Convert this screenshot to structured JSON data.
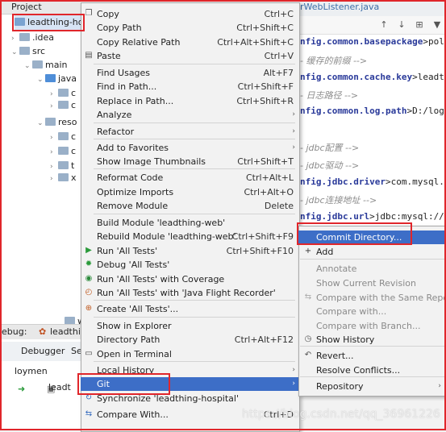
{
  "project_panel": {
    "header": "Project",
    "tree": [
      {
        "label": "leadthing-hosp",
        "selected": true
      },
      {
        "label": ".idea"
      },
      {
        "label": "src"
      },
      {
        "label": "main"
      },
      {
        "label": "java"
      },
      {
        "label": "c"
      },
      {
        "label": "c"
      },
      {
        "label": "c"
      },
      {
        "label": "reso"
      },
      {
        "label": "c"
      },
      {
        "label": "c"
      },
      {
        "label": "t"
      },
      {
        "label": "x"
      },
      {
        "label": "web"
      }
    ]
  },
  "editor": {
    "tab_label": "rWebListener.java",
    "lines": [
      {
        "key": "nfig.common.basepackage",
        "rest": ">polar"
      },
      {
        "comment": "- 缓存的前缀 -->"
      },
      {
        "key": "nfig.common.cache.key",
        "rest": ">leadthi"
      },
      {
        "comment": "- 日志路径 -->"
      },
      {
        "key": "nfig.common.log.path",
        "rest": ">D:/logs"
      },
      {
        "comment": "- jdbc配置 -->"
      },
      {
        "comment": "- jdbc驱动 -->"
      },
      {
        "key": "nfig.jdbc.driver",
        "rest": ">com.mysql.j"
      },
      {
        "comment": "- jdbc连接地址 -->"
      },
      {
        "key": "nfig.jdbc.url",
        "rest": ">jdbc:mysql://1"
      }
    ]
  },
  "debug_panel": {
    "label": "ebug:",
    "config": "leadthi",
    "tabs": [
      "Debugger",
      "Se"
    ],
    "thread": "loymen",
    "frame": "leadt"
  },
  "context_menu": {
    "items": [
      {
        "label": "Copy",
        "shortcut": "Ctrl+C",
        "icon": "copy-icon"
      },
      {
        "label": "Copy Path",
        "shortcut": "Ctrl+Shift+C"
      },
      {
        "label": "Copy Relative Path",
        "shortcut": "Ctrl+Alt+Shift+C"
      },
      {
        "label": "Paste",
        "shortcut": "Ctrl+V",
        "icon": "paste-icon"
      },
      {
        "label": "Find Usages",
        "shortcut": "Alt+F7"
      },
      {
        "label": "Find in Path...",
        "shortcut": "Ctrl+Shift+F"
      },
      {
        "label": "Replace in Path...",
        "shortcut": "Ctrl+Shift+R"
      },
      {
        "label": "Analyze",
        "submenu": true
      },
      {
        "label": "Refactor",
        "submenu": true
      },
      {
        "label": "Add to Favorites",
        "submenu": true
      },
      {
        "label": "Show Image Thumbnails",
        "shortcut": "Ctrl+Shift+T"
      },
      {
        "label": "Reformat Code",
        "shortcut": "Ctrl+Alt+L"
      },
      {
        "label": "Optimize Imports",
        "shortcut": "Ctrl+Alt+O"
      },
      {
        "label": "Remove Module",
        "shortcut": "Delete"
      },
      {
        "label": "Build Module 'leadthing-web'"
      },
      {
        "label": "Rebuild Module 'leadthing-web'",
        "shortcut": "Ctrl+Shift+F9"
      },
      {
        "label": "Run 'All Tests'",
        "shortcut": "Ctrl+Shift+F10",
        "icon": "run-icon"
      },
      {
        "label": "Debug 'All Tests'",
        "icon": "debug-icon"
      },
      {
        "label": "Run 'All Tests' with Coverage",
        "icon": "coverage-icon"
      },
      {
        "label": "Run 'All Tests' with 'Java Flight Recorder'",
        "icon": "flight-recorder-icon"
      },
      {
        "label": "Create 'All Tests'...",
        "icon": "create-test-icon"
      },
      {
        "label": "Show in Explorer"
      },
      {
        "label": "Directory Path",
        "shortcut": "Ctrl+Alt+F12"
      },
      {
        "label": "Open in Terminal",
        "icon": "terminal-icon"
      },
      {
        "label": "Local History",
        "submenu": true
      },
      {
        "label": "Git",
        "submenu": true,
        "highlighted": true
      },
      {
        "label": "Synchronize 'leadthing-hospital'",
        "icon": "sync-icon"
      },
      {
        "label": "Compare With...",
        "shortcut": "Ctrl+D",
        "icon": "compare-icon"
      }
    ]
  },
  "git_submenu": {
    "items": [
      {
        "label": "Commit Directory...",
        "highlighted": true
      },
      {
        "label": "Add",
        "icon": "plus-icon"
      },
      {
        "label": "Annotate",
        "disabled": true
      },
      {
        "label": "Show Current Revision",
        "disabled": true
      },
      {
        "label": "Compare with the Same Repository Version",
        "disabled": true,
        "icon": "compare-icon"
      },
      {
        "label": "Compare with...",
        "disabled": true
      },
      {
        "label": "Compare with Branch...",
        "disabled": true
      },
      {
        "label": "Show History",
        "icon": "history-icon"
      },
      {
        "label": "Revert...",
        "icon": "revert-icon"
      },
      {
        "label": "Resolve Conflicts..."
      },
      {
        "label": "Repository",
        "submenu": true
      }
    ]
  },
  "watermark": "https://blog.csdn.net/qq_36961226",
  "colors": {
    "highlight": "#3d6ec7",
    "annotation_red": "#e0262b",
    "code_key": "#2a3a9a"
  }
}
